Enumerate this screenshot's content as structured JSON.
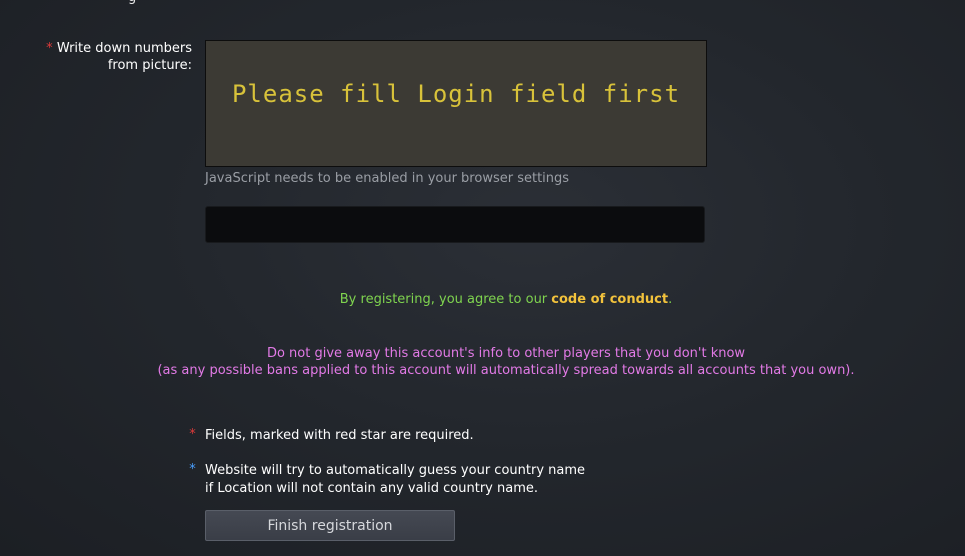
{
  "top_cutoff": "g",
  "captcha": {
    "required_star": "*",
    "label": "Write down numbers from picture:",
    "image_text": "Please fill Login field first",
    "js_note": "JavaScript needs to be enabled in your browser settings",
    "input_value": ""
  },
  "agreement": {
    "prefix": "By registering, you agree to our ",
    "link": "code of conduct",
    "suffix": "."
  },
  "warning": {
    "line1": "Do not give away this account's info to other players that you don't know",
    "line2": "(as any possible bans applied to this account will automatically spread towards all accounts that you own)."
  },
  "notes": {
    "required_star": "*",
    "required_text": "Fields, marked with red star are required.",
    "country_star": "*",
    "country_line1": "Website will try to automatically guess your country name",
    "country_line2": "if Location will not contain any valid country name."
  },
  "finish_button": "Finish registration",
  "colors": {
    "required": "#e03a3a",
    "info": "#4aa0ff",
    "agreement": "#7fd44f",
    "link": "#f2c23c",
    "warning": "#e27ae6",
    "captcha_text": "#d8c23a"
  }
}
